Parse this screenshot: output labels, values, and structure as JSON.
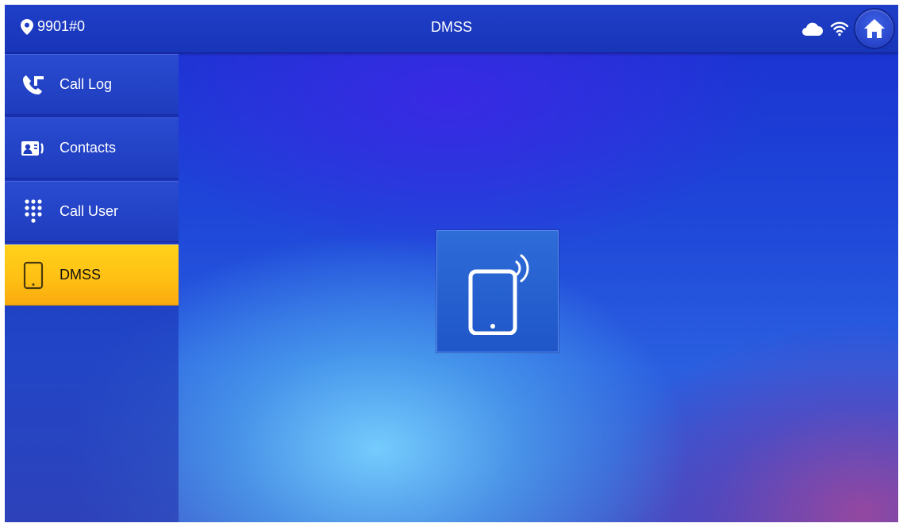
{
  "header": {
    "location": "9901#0",
    "title": "DMSS"
  },
  "icons": {
    "location": "location-pin-icon",
    "cloud": "cloud-icon",
    "wifi": "wifi-icon",
    "home": "home-icon",
    "tile": "tablet-wireless-icon"
  },
  "sidebar": {
    "items": [
      {
        "label": "Call Log",
        "icon": "call-log-icon",
        "active": false
      },
      {
        "label": "Contacts",
        "icon": "contacts-icon",
        "active": false
      },
      {
        "label": "Call User",
        "icon": "dialpad-icon",
        "active": false
      },
      {
        "label": "DMSS",
        "icon": "tablet-icon",
        "active": true
      }
    ]
  },
  "colors": {
    "accent_active": "#ffc114",
    "topbar": "#1f3fc8",
    "tile": "#2e6cd8"
  }
}
